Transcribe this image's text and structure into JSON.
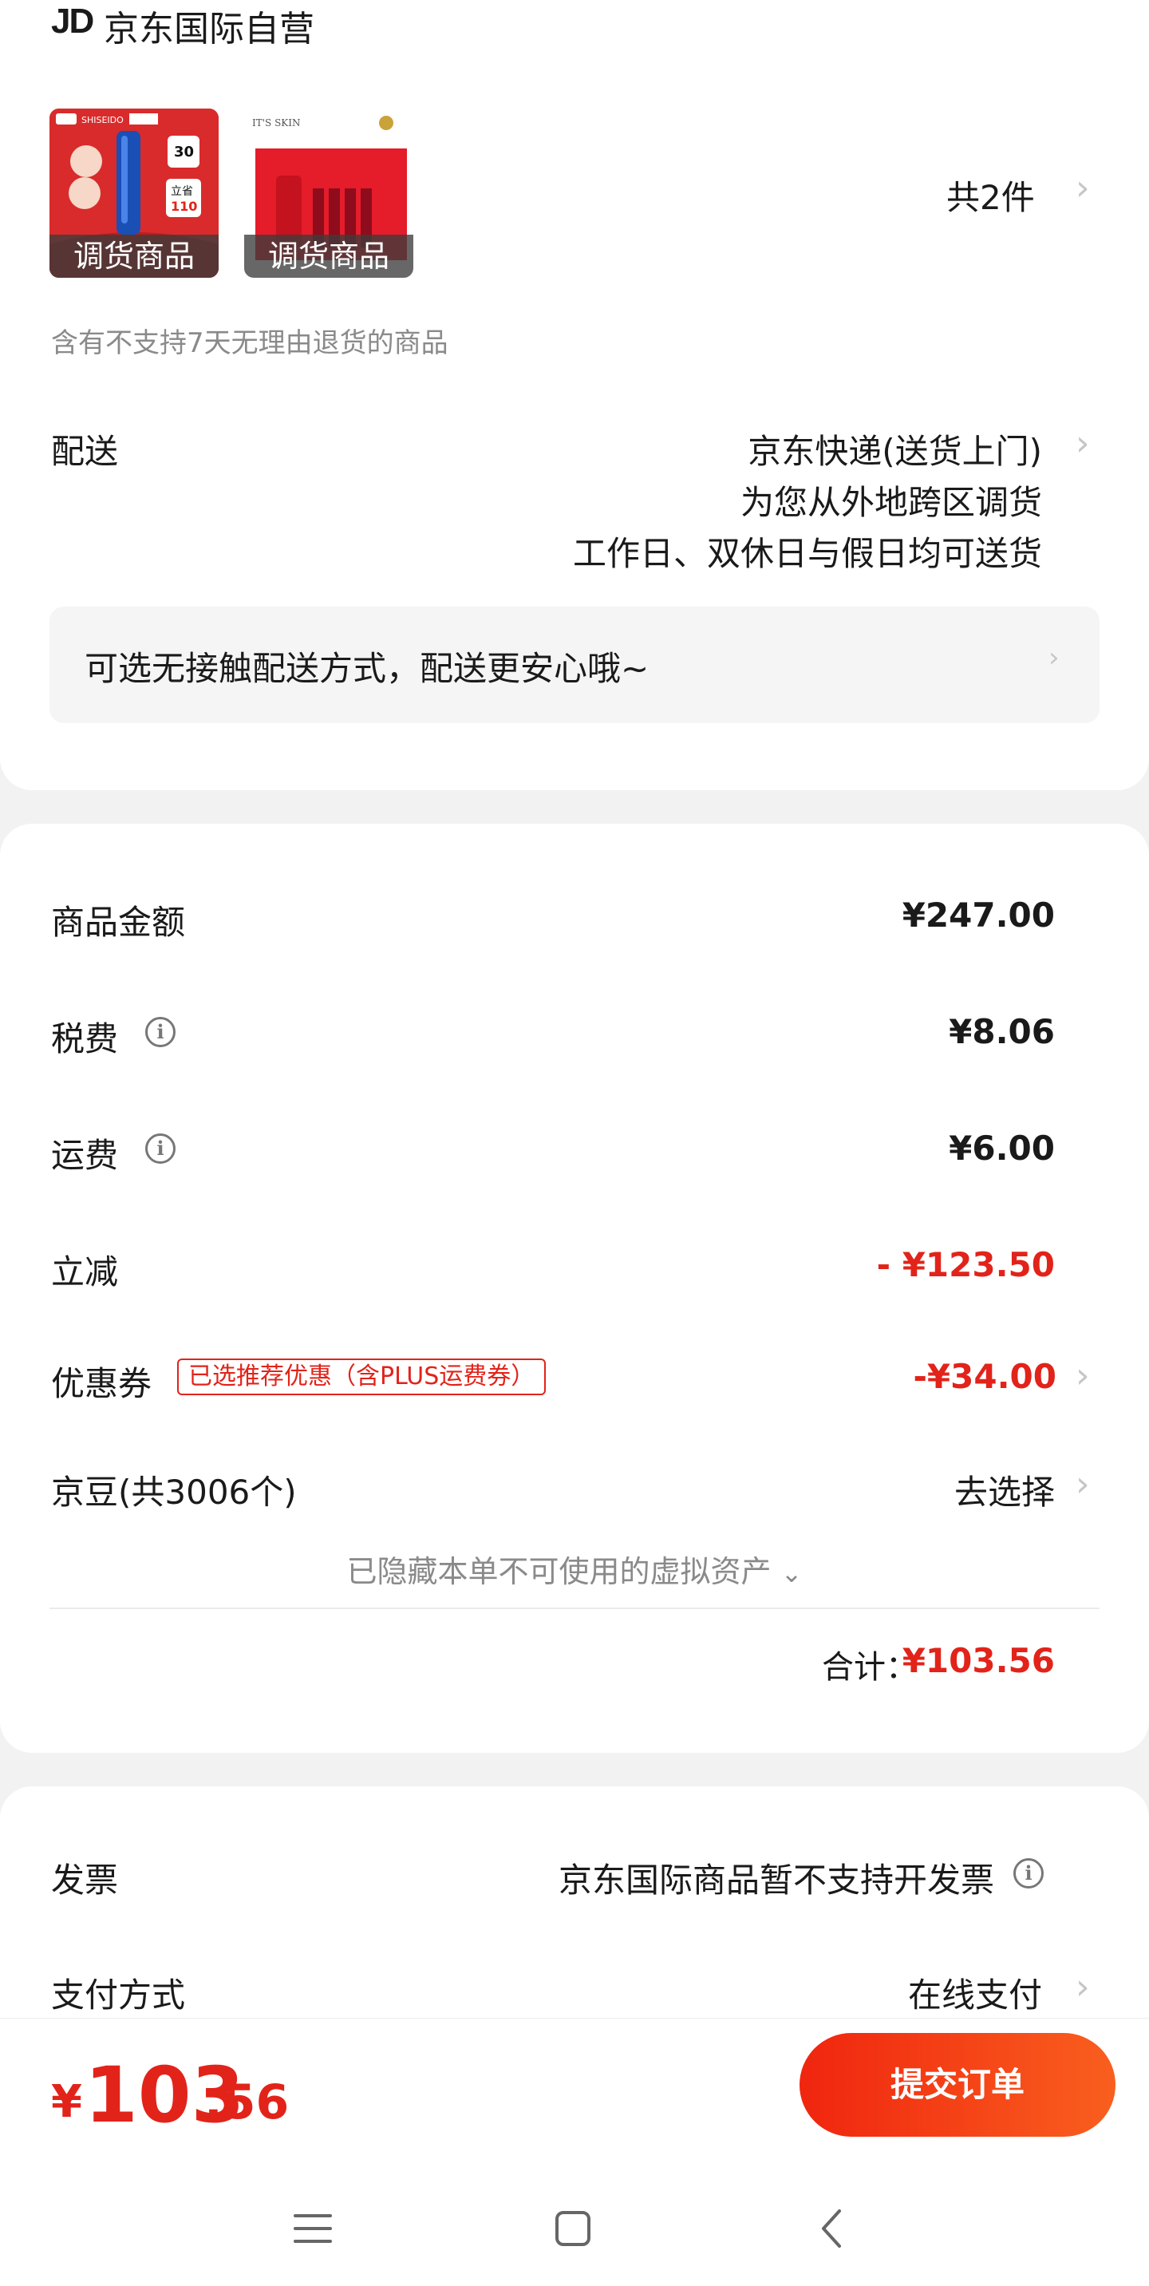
{
  "store": {
    "logo": "JD",
    "name": "京东国际自营"
  },
  "products": {
    "thumb1": {
      "brand": "SHISEIDO",
      "badge": "30",
      "save_label": "立省",
      "save_value": "110",
      "tag": "调货商品"
    },
    "thumb2": {
      "brand": "IT'S SKIN",
      "tag": "调货商品"
    },
    "count": "共2件",
    "return_note": "含有不支持7天无理由退货的商品"
  },
  "delivery": {
    "label": "配送",
    "method": "京东快递(送货上门)",
    "line2": "为您从外地跨区调货",
    "line3": "工作日、双休日与假日均可送货",
    "contactless": "可选无接触配送方式，配送更安心哦~"
  },
  "summary": {
    "goods_label": "商品金额",
    "goods_value": "¥247.00",
    "tax_label": "税费",
    "tax_value": "¥8.06",
    "shipping_label": "运费",
    "shipping_value": "¥6.00",
    "discount_label": "立减",
    "discount_value": "- ¥123.50",
    "coupon_label": "优惠券",
    "coupon_badge": "已选推荐优惠（含PLUS运费券）",
    "coupon_value": "-¥34.00",
    "beans_label": "京豆(共3006个)",
    "beans_value": "去选择",
    "hidden_assets": "已隐藏本单不可使用的虚拟资产",
    "total_label": "合计：",
    "total_value": "¥103.56"
  },
  "invoice": {
    "label": "发票",
    "value": "京东国际商品暂不支持开发票"
  },
  "payment": {
    "label": "支付方式",
    "value": "在线支付"
  },
  "bottom": {
    "currency": "¥",
    "amount_int": "103",
    "amount_dec": ".56",
    "submit": "提交订单"
  },
  "icons": {
    "chevron": "chevron-right-icon",
    "info": "info-icon",
    "chevron_down": "chevron-down-icon",
    "nav": [
      "menu-icon",
      "home-icon",
      "back-icon"
    ]
  },
  "colors": {
    "accent": "#e2231a",
    "button_start": "#f0250f",
    "button_end": "#f95f1e"
  }
}
